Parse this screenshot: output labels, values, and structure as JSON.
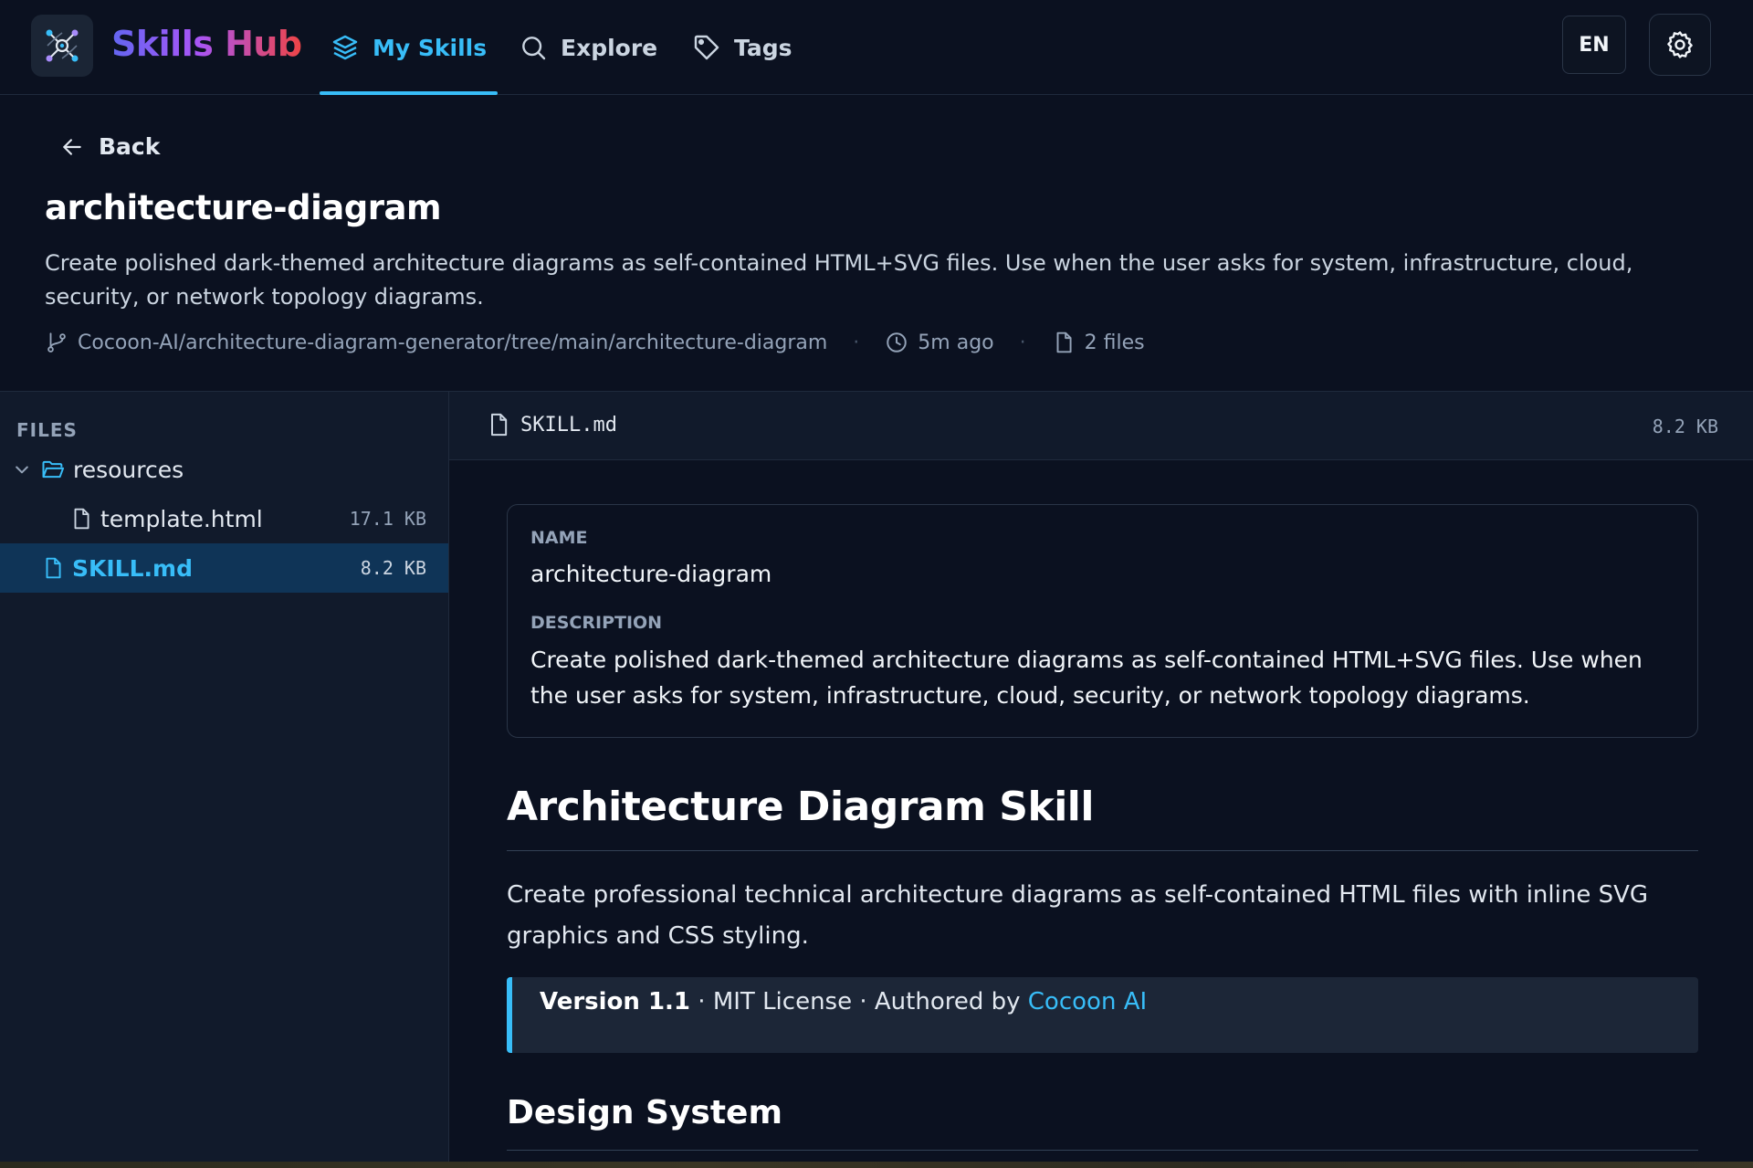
{
  "app": {
    "brand": "Skills Hub",
    "nav": [
      {
        "label": "My Skills",
        "icon": "layers-icon",
        "active": true
      },
      {
        "label": "Explore",
        "icon": "search-icon",
        "active": false
      },
      {
        "label": "Tags",
        "icon": "tag-icon",
        "active": false
      }
    ],
    "language": "EN",
    "accent_color": "#38bdf8"
  },
  "header": {
    "back_label": "Back",
    "title": "architecture-diagram",
    "description": "Create polished dark-themed architecture diagrams as self-contained HTML+SVG files. Use when the user asks for system, infrastructure, cloud, security, or network topology diagrams.",
    "source_path": "Cocoon-AI/architecture-diagram-generator/tree/main/architecture-diagram",
    "updated": "5m ago",
    "file_count": "2 files"
  },
  "sidebar": {
    "heading": "FILES",
    "tree": [
      {
        "type": "folder",
        "name": "resources",
        "expanded": true
      },
      {
        "type": "file",
        "name": "template.html",
        "size": "17.1 KB"
      },
      {
        "type": "file",
        "name": "SKILL.md",
        "size": "8.2 KB",
        "selected": true
      }
    ]
  },
  "viewer": {
    "file_name": "SKILL.md",
    "file_size": "8.2 KB",
    "frontmatter": {
      "name_label": "NAME",
      "name_value": "architecture-diagram",
      "description_label": "DESCRIPTION",
      "description_value": "Create polished dark-themed architecture diagrams as self-contained HTML+SVG files. Use when the user asks for system, infrastructure, cloud, security, or network topology diagrams."
    },
    "h1": "Architecture Diagram Skill",
    "intro": "Create professional technical architecture diagrams as self-contained HTML files with inline SVG graphics and CSS styling.",
    "quote": {
      "version": "Version 1.1",
      "license": " · MIT License · Authored by ",
      "author_link": "Cocoon AI"
    },
    "h2": "Design System"
  }
}
